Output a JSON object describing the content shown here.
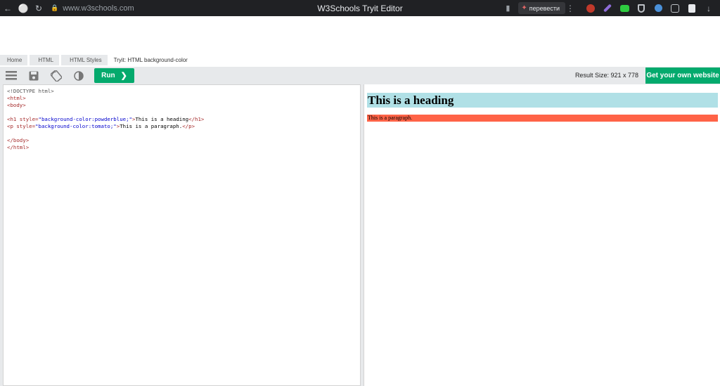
{
  "browser": {
    "url": "www.w3schools.com",
    "window_title": "W3Schools Tryit Editor",
    "translate_label": "перевести"
  },
  "breadcrumb": {
    "items": [
      "Home",
      "HTML",
      "HTML Styles"
    ],
    "current": "Tryit: HTML background-color"
  },
  "toolbar": {
    "run_label": "Run",
    "result_size": "Result Size: 921 x 778",
    "own_website_label": "Get your own website"
  },
  "code": {
    "lines": {
      "l1": "<!DOCTYPE html>",
      "l2": "<html>",
      "l3": "<body>",
      "h1_open": "<h1",
      "h1_attr": " style=",
      "h1_val": "\"background-color:powderblue;\"",
      "h1_gt": ">",
      "h1_text": "This is a heading",
      "h1_close": "</h1>",
      "p_open": "<p",
      "p_attr": " style=",
      "p_val": "\"background-color:tomato;\"",
      "p_gt": ">",
      "p_text": "This is a paragraph.",
      "p_close": "</p>",
      "l6": "</body>",
      "l7": "</html>"
    }
  },
  "result": {
    "heading": "This is a heading",
    "paragraph": "This is a paragraph."
  },
  "colors": {
    "run_green": "#04aa6d",
    "heading_bg": "#b0e0e6",
    "paragraph_bg": "#ff6347"
  }
}
